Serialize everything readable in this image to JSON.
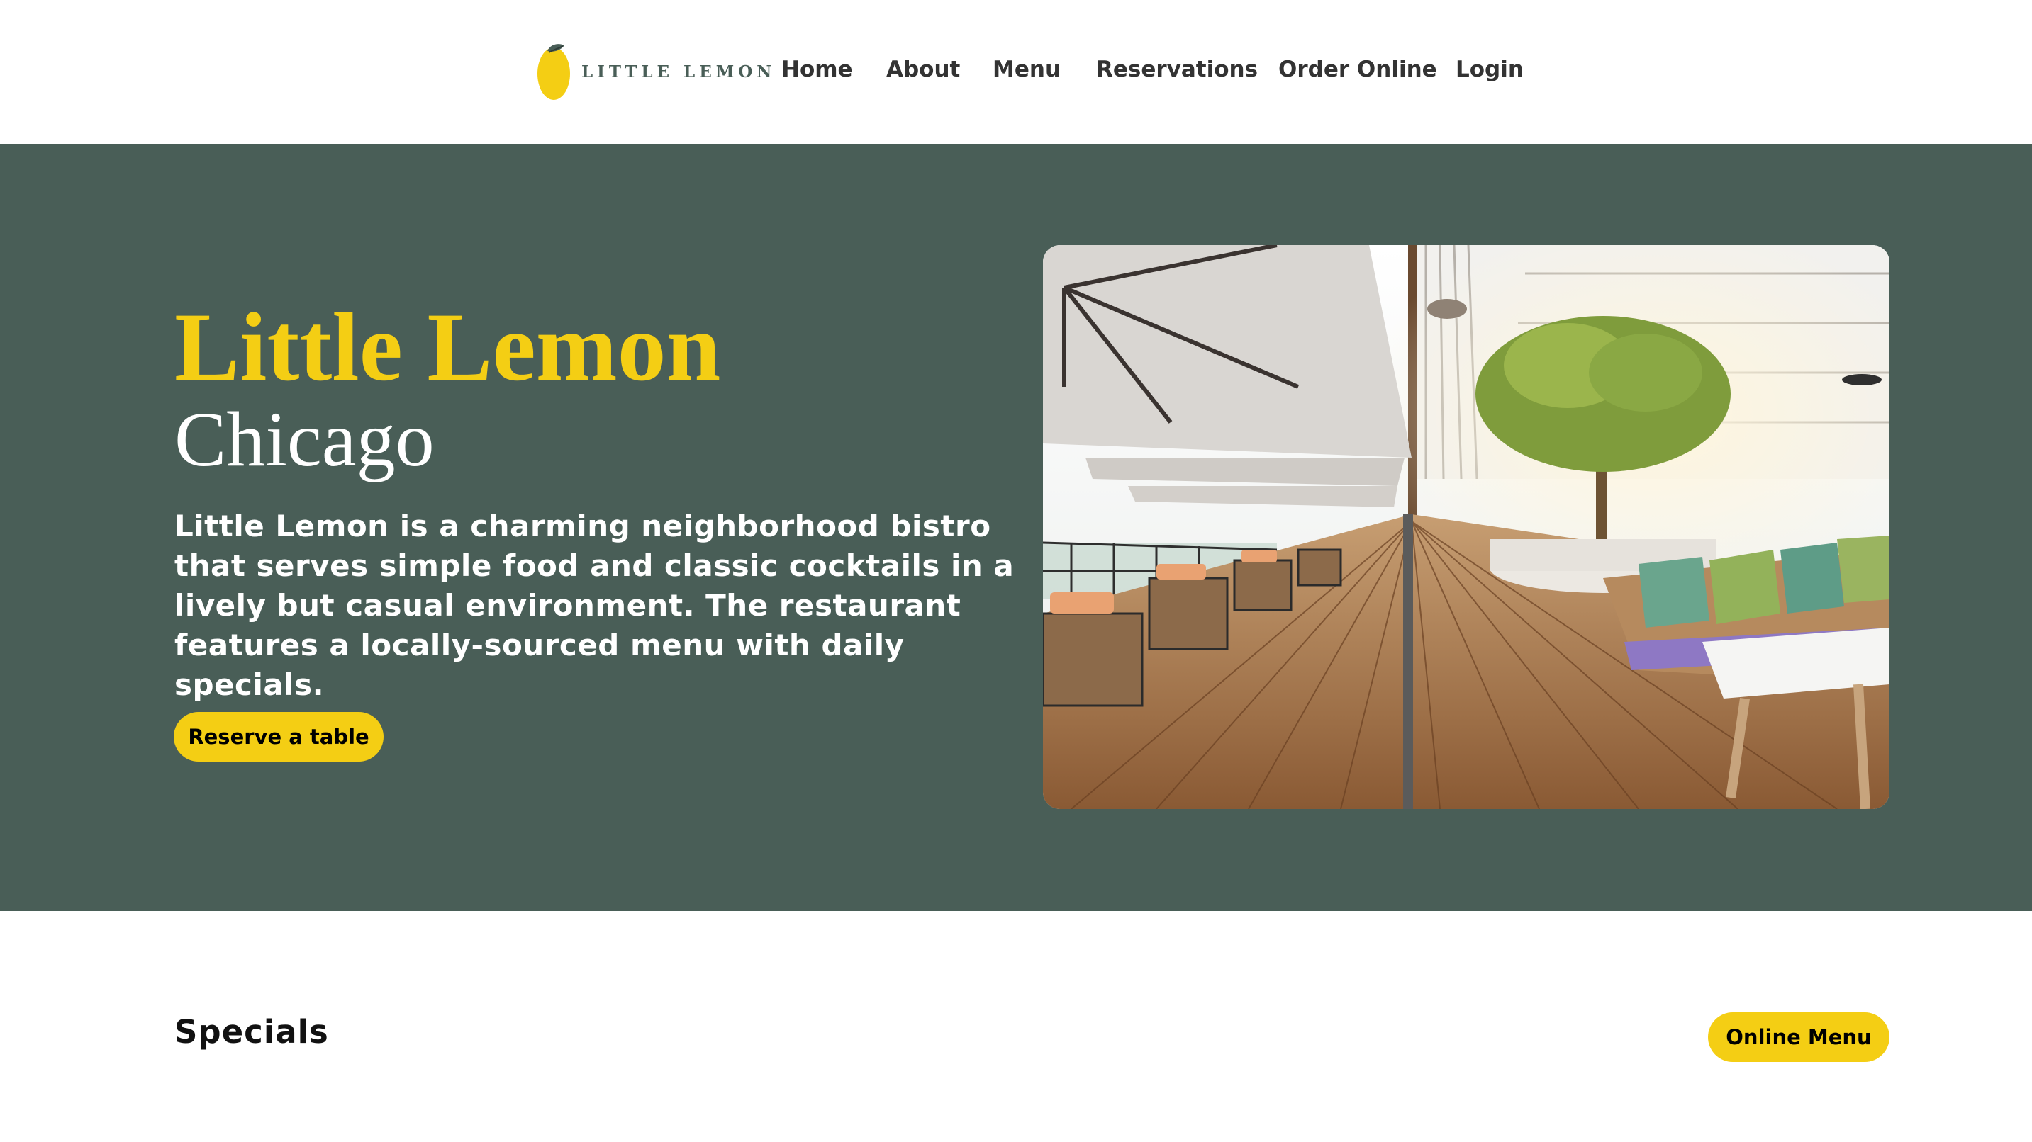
{
  "header": {
    "logo": {
      "text": "LITTLE LEMON",
      "icon": "lemon-icon"
    },
    "nav": [
      {
        "label": "Home"
      },
      {
        "label": "About"
      },
      {
        "label": "Menu"
      },
      {
        "label": "Reservations"
      },
      {
        "label": "Order Online"
      },
      {
        "label": "Login"
      }
    ]
  },
  "hero": {
    "title": "Little Lemon",
    "subtitle": "Chicago",
    "description": "Little Lemon is a charming neighborhood bistro that serves simple food and classic cocktails in a lively but casual environment. The restaurant features a locally-sourced menu with daily specials.",
    "cta_label": "Reserve a table",
    "image": "restaurant-terrace-photo"
  },
  "specials": {
    "title": "Specials",
    "cta_label": "Online Menu"
  },
  "colors": {
    "primary_green": "#495e57",
    "primary_yellow": "#f4ce14",
    "nav_text": "#333333",
    "white": "#ffffff"
  }
}
